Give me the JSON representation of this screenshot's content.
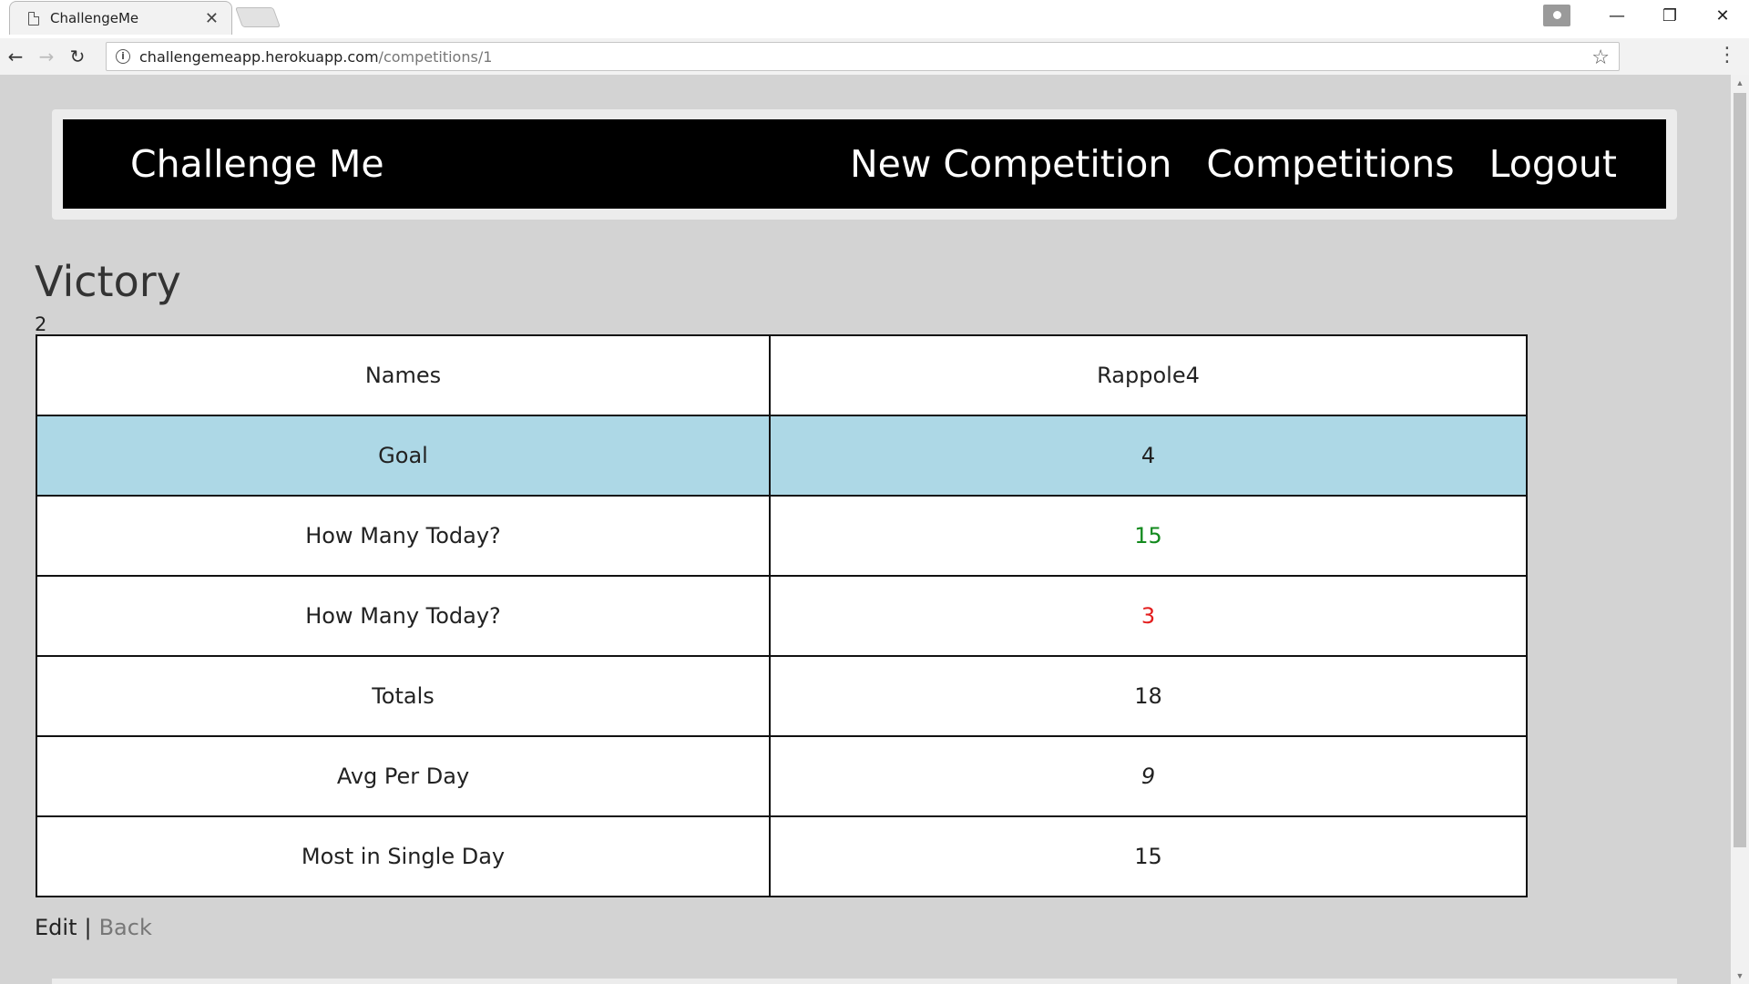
{
  "browser": {
    "tab_title": "ChallengeMe",
    "url_host": "challengemeapp.herokuapp.com",
    "url_path": "/competitions/1"
  },
  "navbar": {
    "brand": "Challenge Me",
    "links": [
      "New Competition",
      "Competitions",
      "Logout"
    ]
  },
  "page": {
    "title": "Victory",
    "subtitle": "2"
  },
  "table": {
    "rows": [
      {
        "label": "Names",
        "value": "Rappole4"
      },
      {
        "label": "Goal",
        "value": "4"
      },
      {
        "label": "How Many Today?",
        "value": "15"
      },
      {
        "label": "How Many Today?",
        "value": "3"
      },
      {
        "label": "Totals",
        "value": "18"
      },
      {
        "label": "Avg Per Day",
        "value": "9"
      },
      {
        "label": "Most in Single Day",
        "value": "15"
      }
    ]
  },
  "actions": {
    "edit": "Edit",
    "separator": "|",
    "back": "Back"
  },
  "colors": {
    "highlight_row": "#add8e6",
    "above_goal": "#138a1e",
    "below_goal": "#e31d1d",
    "navbar_bg": "#000000",
    "page_bg": "#d3d3d3"
  }
}
